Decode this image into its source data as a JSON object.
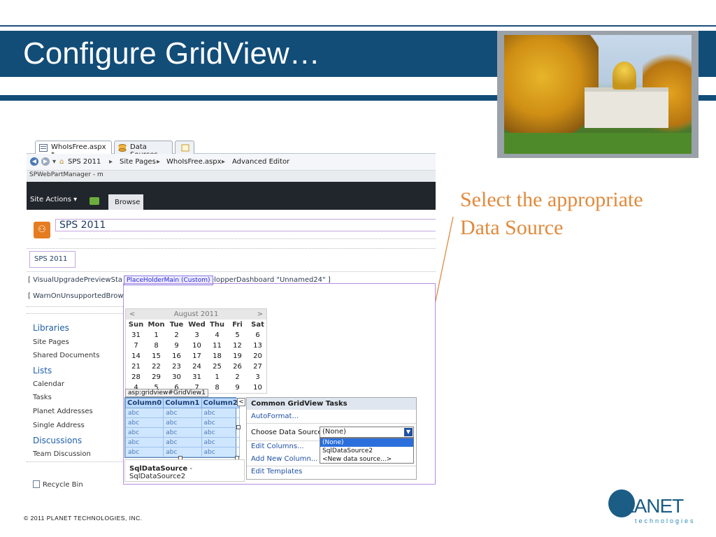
{
  "slide": {
    "title": "Configure GridView…",
    "callout": "Select the appropriate Data Source",
    "copyright": "© 2011 PLANET TECHNOLOGIES, INC.",
    "logo_word": "LANET",
    "logo_sub": "technologies",
    "colors": {
      "header_blue": "#124d78",
      "callout_orange": "#e08a3c"
    }
  },
  "editor": {
    "tabs": [
      {
        "label": "WhoIsFree.aspx *",
        "icon": "aspx-file-icon"
      },
      {
        "label": "Data Sources",
        "icon": "data-sources-icon"
      },
      {
        "label": "",
        "icon": "new-tab-icon"
      }
    ],
    "breadcrumb": [
      "SPS 2011",
      "Site Pages",
      "WhoIsFree.aspx",
      "Advanced Editor"
    ],
    "webpart_manager": "SPWebPartManager - m"
  },
  "sharepoint": {
    "site_actions": "Site Actions",
    "browse_tab": "Browse",
    "site_title": "SPS 2011",
    "sps_box": "SPS 2011",
    "ctl_upgrade": "[ VisualUpgradePreviewSta",
    "ctl_dashboard": "velopperDashboard \"Unnamed24\" ]",
    "ctl_warn": "[ WarnOnUnsupportedBrow",
    "placeholder_label": "PlaceHolderMain (Custom)",
    "quick_launch": [
      {
        "label": "Libraries",
        "heading": true
      },
      {
        "label": "Site Pages",
        "heading": false
      },
      {
        "label": "Shared Documents",
        "heading": false
      },
      {
        "label": "Lists",
        "heading": true
      },
      {
        "label": "Calendar",
        "heading": false
      },
      {
        "label": "Tasks",
        "heading": false
      },
      {
        "label": "Planet Addresses",
        "heading": false
      },
      {
        "label": "Single Address",
        "heading": false
      },
      {
        "label": "Discussions",
        "heading": true
      },
      {
        "label": "Team Discussion",
        "heading": false
      }
    ],
    "recycle_bin": "Recycle Bin"
  },
  "calendar": {
    "month": "August 2011",
    "prev": "<",
    "next": ">",
    "days": [
      "Sun",
      "Mon",
      "Tue",
      "Wed",
      "Thu",
      "Fri",
      "Sat"
    ],
    "weeks": [
      [
        "31",
        "1",
        "2",
        "3",
        "4",
        "5",
        "6"
      ],
      [
        "7",
        "8",
        "9",
        "10",
        "11",
        "12",
        "13"
      ],
      [
        "14",
        "15",
        "16",
        "17",
        "18",
        "19",
        "20"
      ],
      [
        "21",
        "22",
        "23",
        "24",
        "25",
        "26",
        "27"
      ],
      [
        "28",
        "29",
        "30",
        "31",
        "1",
        "2",
        "3"
      ],
      [
        "4",
        "5",
        "6",
        "7",
        "8",
        "9",
        "10"
      ]
    ]
  },
  "gridview": {
    "tag": "asp:gridview#GridView1",
    "columns": [
      "Column0",
      "Column1",
      "Column2"
    ],
    "rows": [
      [
        "abc",
        "abc",
        "abc"
      ],
      [
        "abc",
        "abc",
        "abc"
      ],
      [
        "abc",
        "abc",
        "abc"
      ],
      [
        "abc",
        "abc",
        "abc"
      ],
      [
        "abc",
        "abc",
        "abc"
      ]
    ],
    "smart_tag": "<",
    "datasource_name": "SqlDataSource",
    "datasource_id": " - SqlDataSource2"
  },
  "tasks": {
    "header": "Common GridView Tasks",
    "autoformat": "AutoFormat...",
    "choose_label": "Choose Data Source:",
    "selected": "(None)",
    "options": [
      "(None)",
      "SqlDataSource2",
      "<New data source...>"
    ],
    "edit_columns": "Edit Columns...",
    "add_column": "Add New Column...",
    "edit_templates": "Edit Templates"
  }
}
